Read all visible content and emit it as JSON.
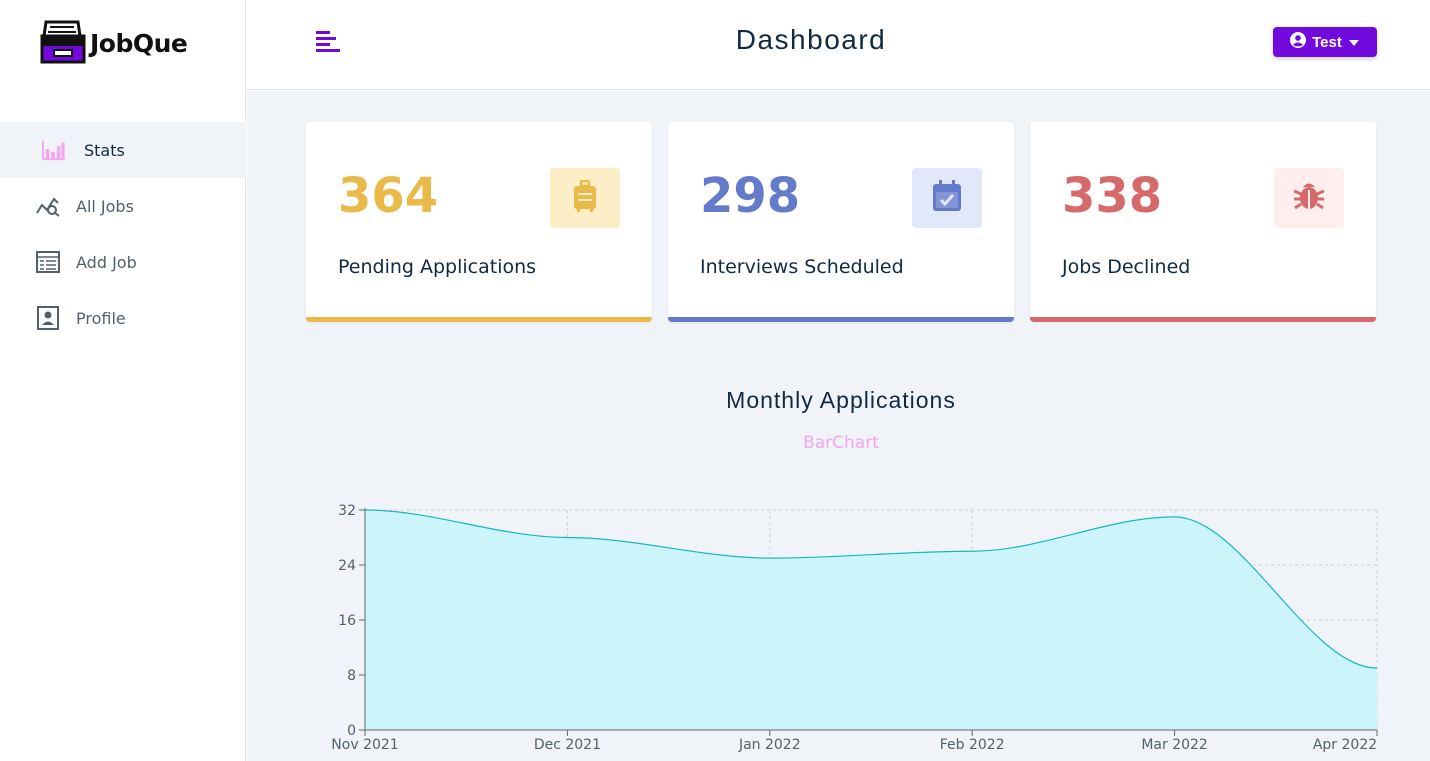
{
  "brand": {
    "name": "JobQue"
  },
  "header": {
    "title": "Dashboard",
    "user_label": "Test"
  },
  "sidebar": {
    "items": [
      {
        "label": "Stats",
        "icon": "bar-chart-icon",
        "active": true
      },
      {
        "label": "All Jobs",
        "icon": "job-search-icon",
        "active": false
      },
      {
        "label": "Add Job",
        "icon": "form-icon",
        "active": false
      },
      {
        "label": "Profile",
        "icon": "profile-icon",
        "active": false
      }
    ]
  },
  "stats": [
    {
      "count": "364",
      "label": "Pending Applications",
      "icon": "suitcase-icon",
      "color": "#e9b949",
      "bg": "#fcefc7"
    },
    {
      "count": "298",
      "label": "Interviews Scheduled",
      "icon": "calendar-check-icon",
      "color": "#647acb",
      "bg": "#e0e8f9"
    },
    {
      "count": "338",
      "label": "Jobs Declined",
      "icon": "bug-icon",
      "color": "#d66a6a",
      "bg": "#ffeeee"
    }
  ],
  "chart": {
    "title": "Monthly Applications",
    "toggle_label": "BarChart"
  },
  "colors": {
    "accent": "#7209dd",
    "area_fill": "#cbf4fb",
    "area_stroke": "#1ab6c4"
  },
  "chart_data": {
    "type": "area",
    "categories": [
      "Nov 2021",
      "Dec 2021",
      "Jan 2022",
      "Feb 2022",
      "Mar 2022",
      "Apr 2022"
    ],
    "values": [
      32,
      28,
      25,
      26,
      31,
      9
    ],
    "ylim": [
      0,
      32
    ],
    "yticks": [
      0,
      8,
      16,
      24,
      32
    ],
    "grid": true
  }
}
